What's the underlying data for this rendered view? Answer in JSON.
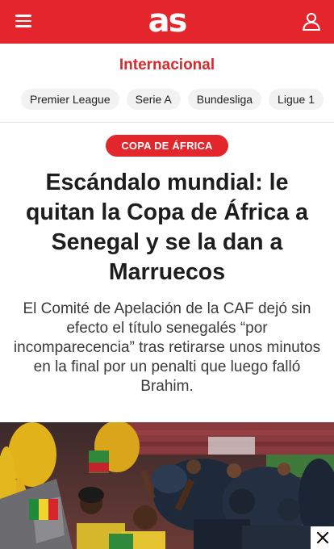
{
  "header": {
    "logo": "as",
    "menu_icon": "hamburger-menu-icon",
    "user_icon": "user-account-icon",
    "brand_color": "#e4262c"
  },
  "section": {
    "title": "Internacional"
  },
  "nav": {
    "chips": [
      "Premier League",
      "Serie A",
      "Bundesliga",
      "Ligue 1"
    ]
  },
  "article": {
    "tag": "COPA DE ÁFRICA",
    "headline": "Escándalo mundial: le quitan la Copa de África a Senegal y se la dan a Marruecos",
    "subtitle": "El Comité de Apelación de la CAF dejó sin efecto el título senegalés “por incomparecencia” tras retirarse unos minutos en la final por un penalti que luego falló Brahim."
  },
  "overlay": {
    "close_icon": "close-icon"
  }
}
